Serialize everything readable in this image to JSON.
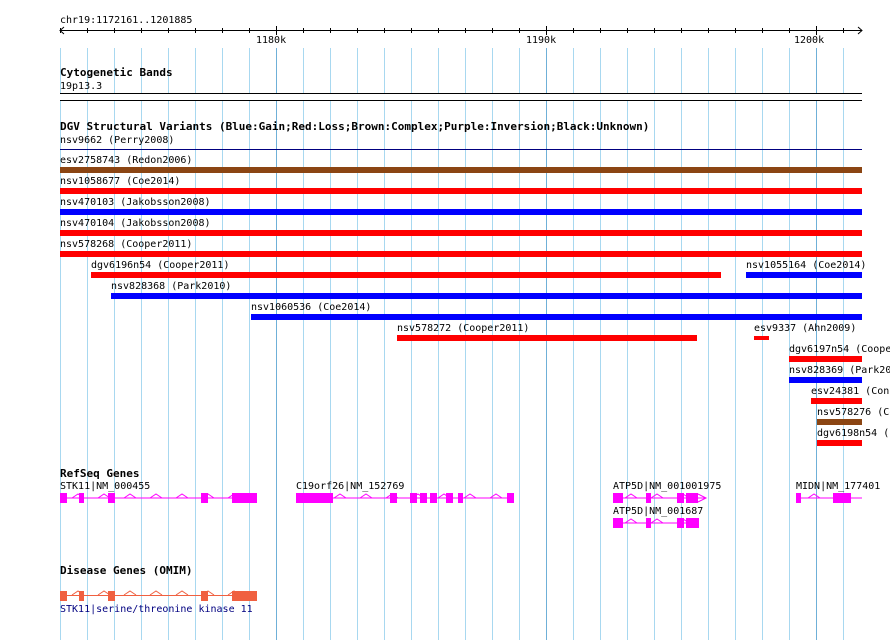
{
  "ruler": {
    "locus": "chr19:1172161..1201885",
    "ticks": [
      "1180k",
      "1190k",
      "1200k"
    ]
  },
  "cytoband": {
    "title": "Cytogenetic Bands",
    "band": "19p13.3"
  },
  "dgv": {
    "title": "DGV Structural Variants (Blue:Gain;Red:Loss;Brown:Complex;Purple:Inversion;Black:Unknown)",
    "colors": {
      "gain": "#0000ff",
      "loss": "#ff0000",
      "complex": "#8b4513",
      "unknown": "#000000"
    },
    "variants": [
      {
        "label": "nsv9662 (Perry2008)",
        "type": "unknown"
      },
      {
        "label": "esv2758743 (Redon2006)",
        "type": "complex"
      },
      {
        "label": "nsv1058677 (Coe2014)",
        "type": "loss"
      },
      {
        "label": "nsv470103 (Jakobsson2008)",
        "type": "gain"
      },
      {
        "label": "nsv470104 (Jakobsson2008)",
        "type": "loss"
      },
      {
        "label": "nsv578268 (Cooper2011)",
        "type": "loss"
      },
      {
        "label": "dgv6196n54 (Cooper2011)",
        "type": "loss"
      },
      {
        "label": "nsv1055164 (Coe2014)",
        "type": "gain"
      },
      {
        "label": "nsv828368 (Park2010)",
        "type": "gain"
      },
      {
        "label": "nsv1060536 (Coe2014)",
        "type": "gain"
      },
      {
        "label": "nsv578272 (Cooper2011)",
        "type": "loss"
      },
      {
        "label": "esv9337 (Ahn2009)",
        "type": "loss"
      },
      {
        "label": "dgv6197n54 (Coope",
        "type": "loss"
      },
      {
        "label": "nsv828369 (Park20",
        "type": "gain"
      },
      {
        "label": "esv24381 (Conr",
        "type": "loss"
      },
      {
        "label": "nsv578276 (Co",
        "type": "complex"
      },
      {
        "label": "dgv6198n54 (",
        "type": "loss"
      }
    ]
  },
  "refseq": {
    "title": "RefSeq Genes",
    "color": "#ff00ff",
    "genes": [
      {
        "label": "STK11|NM_000455"
      },
      {
        "label": "C19orf26|NM_152769"
      },
      {
        "label": "ATP5D|NM_001001975"
      },
      {
        "label": "ATP5D|NM_001687"
      },
      {
        "label": "MIDN|NM_177401"
      }
    ]
  },
  "omim": {
    "title": "Disease Genes (OMIM)",
    "color": "#f06040",
    "gene_label": "STK11|serine/threonine kinase 11"
  }
}
